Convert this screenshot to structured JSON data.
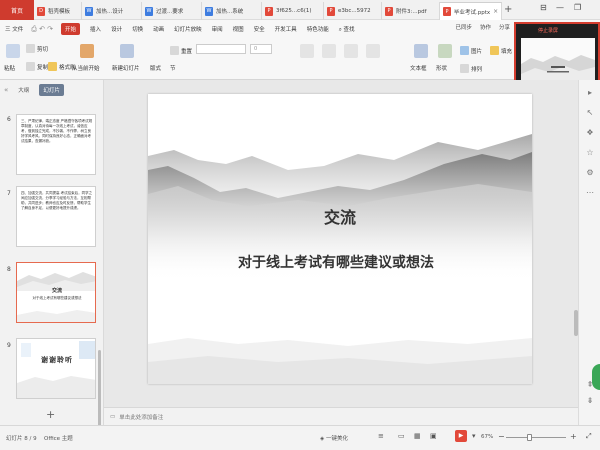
{
  "titlebar": {
    "home": "首页",
    "tabs": [
      {
        "label": "稻壳模板",
        "icon_color": "#e2493a",
        "icon": "docer-icon"
      },
      {
        "label": "加热...设计",
        "icon_color": "#3e7de0",
        "icon": "word-doc-icon"
      },
      {
        "label": "过渡...要求",
        "icon_color": "#3e7de0",
        "icon": "word-doc-icon"
      },
      {
        "label": "加热...系统",
        "icon_color": "#3e7de0",
        "icon": "word-doc-icon"
      },
      {
        "label": "3f625...c6(1)",
        "icon_color": "#e2493a",
        "icon": "pdf-icon"
      },
      {
        "label": "e3bc...5972",
        "icon_color": "#e2493a",
        "icon": "pdf-icon"
      },
      {
        "label": "附件3:...pdf",
        "icon_color": "#e2493a",
        "icon": "pdf-icon"
      },
      {
        "label": "毕业考试.pptx",
        "icon_color": "#e2493a",
        "icon": "ppt-icon"
      }
    ],
    "add": "+",
    "controls": [
      "⊟",
      "—",
      "❐"
    ]
  },
  "menubar": {
    "file": "三 文件",
    "items": [
      "开始",
      "插入",
      "设计",
      "切换",
      "动画",
      "幻灯片放映",
      "审阅",
      "视图",
      "安全",
      "开发工具",
      "特色功能"
    ],
    "active": "开始",
    "search": "查找",
    "right": [
      "已同步",
      "协作",
      "分享"
    ]
  },
  "ribbon": {
    "paste": "粘贴",
    "cut": "剪切",
    "copy": "复制",
    "format_painter": "格式刷",
    "from_current": "从当前开始",
    "new_slide": "新建幻灯片",
    "layout": "版式",
    "section": "节",
    "reset": "重置",
    "font_placeholder": "",
    "size_placeholder": "0",
    "textbox": "文本框",
    "shape": "形状",
    "arrange": "排列",
    "picture": "图片",
    "fill": "填充",
    "format_buttons": [
      "B",
      "I",
      "U",
      "S",
      "X²",
      "X₂",
      "A",
      "A"
    ]
  },
  "thumbpane": {
    "tabs": [
      "大纲",
      "幻灯片"
    ],
    "active_tab": "幻灯片",
    "slides": [
      {
        "num": "6",
        "text": "三、严肃纪律，端正态度 严格遵守各项考试规章制度，认真对待每一次线上考试，诚信应考，做到独立完成，不抄袭、不作弊，树立良好学风考风。同时保持良好心态，正确面对考试结果，查漏补缺。"
      },
      {
        "num": "7",
        "text": "四、加强交流，共同提高 考试结束后，同学之间应加强交流，分享学习经验与方法，互相帮助，共同进步；教师也应及时反馈，帮助学生了解自身不足，以便更好地提升成绩。"
      },
      {
        "num": "8",
        "text": "交流 对于线上考试有哪些建议或想法"
      },
      {
        "num": "9",
        "text": "谢谢聆听"
      }
    ],
    "add": "+"
  },
  "slide": {
    "title": "交流",
    "subtitle": "对于线上考试有哪些建议或想法"
  },
  "notes": {
    "placeholder": "单击此处添加备注"
  },
  "recording": {
    "label": "停止录屏"
  },
  "statusbar": {
    "slide_info": "幻灯片 8 / 9",
    "theme": "Office 主题",
    "beautify": "一键美化",
    "zoom": "67%",
    "minus": "−",
    "plus": "+"
  },
  "colors": {
    "accent": "#cf3b2e",
    "selected_thumb": "#e66a4f"
  }
}
